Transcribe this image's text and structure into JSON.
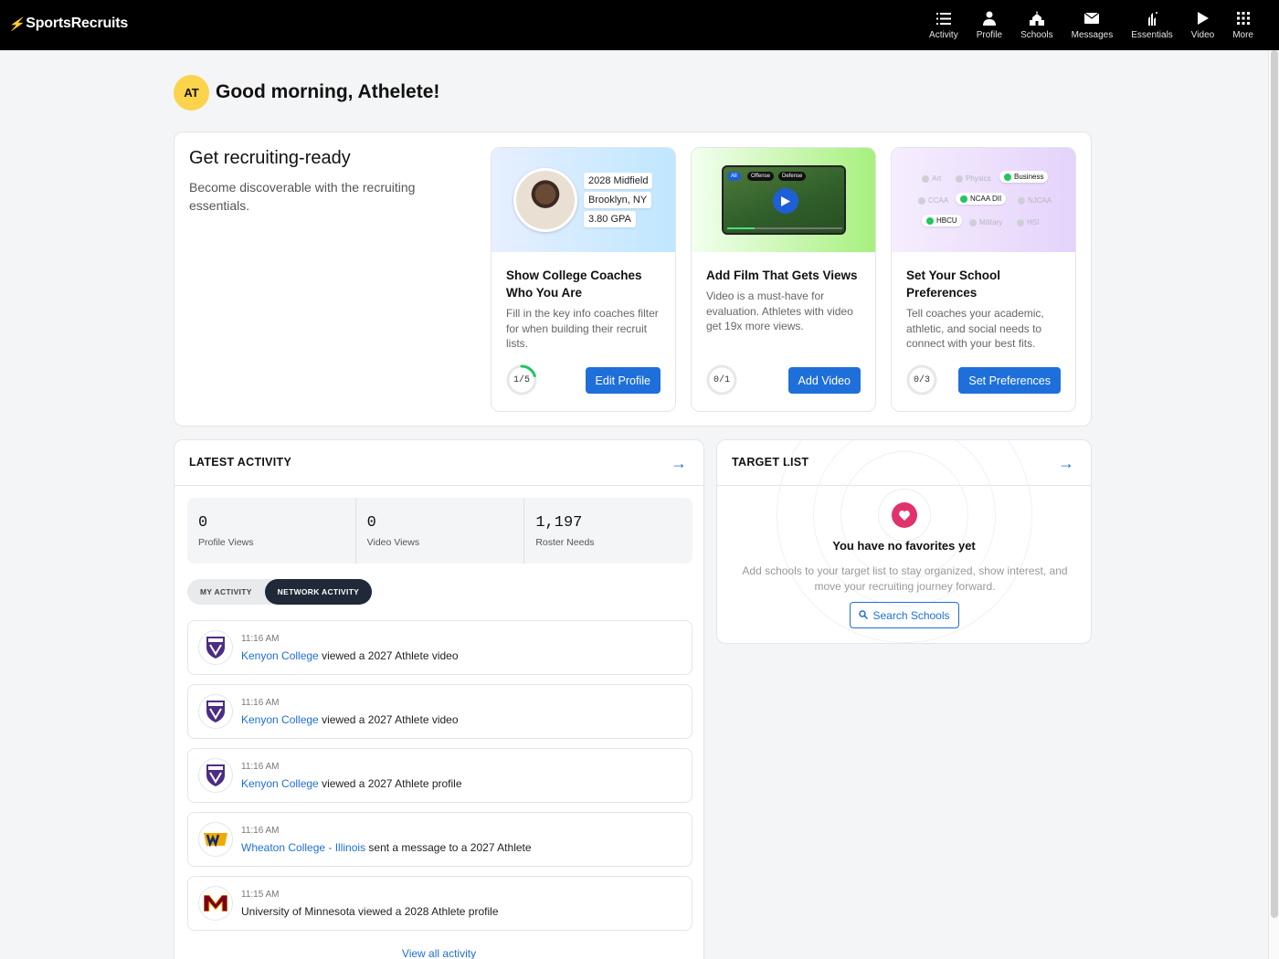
{
  "brand": {
    "name": "SportsRecruits"
  },
  "nav": [
    {
      "label": "Activity",
      "icon": "list-icon"
    },
    {
      "label": "Profile",
      "icon": "person-icon"
    },
    {
      "label": "Schools",
      "icon": "school-icon"
    },
    {
      "label": "Messages",
      "icon": "envelope-icon"
    },
    {
      "label": "Essentials",
      "icon": "essentials-icon"
    },
    {
      "label": "Video",
      "icon": "play-icon"
    },
    {
      "label": "More",
      "icon": "grid-icon"
    }
  ],
  "user": {
    "initials": "AT",
    "greeting": "Good morning, Athelete!"
  },
  "ready": {
    "title": "Get recruiting-ready",
    "subtitle": "Become discoverable with the recruiting essentials.",
    "cards": [
      {
        "title": "Show College Coaches Who You Are",
        "desc": "Fill in the key info coaches filter for when building their recruit lists.",
        "progress": "1/5",
        "progress_fraction": 0.2,
        "button": "Edit Profile",
        "tags": [
          "2028 Midfield",
          "Brooklyn, NY",
          "3.80 GPA"
        ]
      },
      {
        "title": "Add Film That Gets Views",
        "desc": "Video is a must-have for evaluation. Athletes with video get 19x more views.",
        "progress": "0/1",
        "progress_fraction": 0,
        "button": "Add Video",
        "chips": [
          "All",
          "Offense",
          "Defense"
        ]
      },
      {
        "title": "Set Your School Preferences",
        "desc": "Tell coaches your academic, athletic, and social needs to connect with your best fits.",
        "progress": "0/3",
        "progress_fraction": 0,
        "button": "Set Preferences",
        "prefs": [
          {
            "label": "Art",
            "on": false
          },
          {
            "label": "Physics",
            "on": false
          },
          {
            "label": "Business",
            "on": true
          },
          {
            "label": "CCAA",
            "on": false
          },
          {
            "label": "NCAA DII",
            "on": true
          },
          {
            "label": "NJCAA",
            "on": false
          },
          {
            "label": "HBCU",
            "on": true
          },
          {
            "label": "Military",
            "on": false
          },
          {
            "label": "HSI",
            "on": false
          }
        ]
      }
    ]
  },
  "activity": {
    "title": "LATEST ACTIVITY",
    "stats": [
      {
        "value": "0",
        "label": "Profile Views"
      },
      {
        "value": "0",
        "label": "Video Views"
      },
      {
        "value": "1,197",
        "label": "Roster Needs"
      }
    ],
    "tabs": [
      "MY ACTIVITY",
      "NETWORK ACTIVITY"
    ],
    "active_tab": "NETWORK ACTIVITY",
    "items": [
      {
        "time": "11:16 AM",
        "school": "Kenyon College",
        "text": " viewed a 2027 Athlete video"
      },
      {
        "time": "11:16 AM",
        "school": "Kenyon College",
        "text": " viewed a 2027 Athlete video"
      },
      {
        "time": "11:16 AM",
        "school": "Kenyon College",
        "text": " viewed a 2027 Athlete profile"
      },
      {
        "time": "11:16 AM",
        "school": "Wheaton College - Illinois",
        "text": " sent a message to a 2027 Athlete"
      },
      {
        "time": "11:15 AM",
        "school": "",
        "text": "University of Minnesota viewed a 2028 Athlete profile"
      }
    ],
    "view_all": "View all activity"
  },
  "target": {
    "title": "TARGET LIST",
    "empty_title": "You have no favorites yet",
    "empty_desc": "Add schools to your target list to stay organized, show interest, and move your recruiting journey forward.",
    "button": "Search Schools"
  },
  "colors": {
    "accent": "#1e6fd9",
    "avatar": "#fcd34d",
    "heart": "#e1326e",
    "progress": "#22c55e"
  }
}
